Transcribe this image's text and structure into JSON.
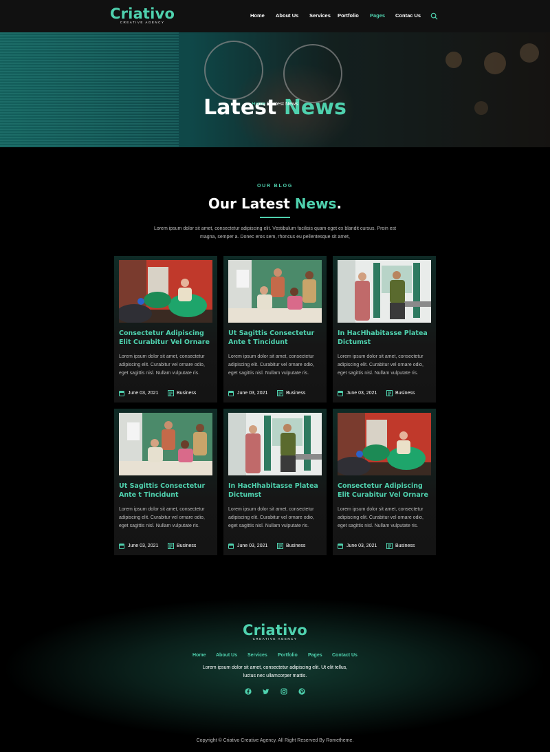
{
  "brand": {
    "name": "Criativo",
    "tagline": "CREATIVE AGENCY",
    "accent": "#4fd1ae"
  },
  "nav": {
    "items": [
      "Home",
      "About Us",
      "Services",
      "Portfolio",
      "Pages",
      "Contac Us"
    ],
    "active": "Pages",
    "search_icon": "search-icon"
  },
  "hero": {
    "title_part1": "Latest",
    "title_part2": "News",
    "crumb_home": "Home",
    "crumb_sep": " / ",
    "crumb_current": "Latest News"
  },
  "blog_section": {
    "label": "OUR BLOG",
    "title_part1": "Our Latest",
    "title_part2": "News",
    "title_end": ".",
    "description": "Lorem ipsum dolor sit amet, consectetur adipiscing elit. Vestibulum facilisis quam eget ex blandit cursus. Proin est magna, semper a. Donec eros sem, rhoncus eu pellentesque sit amet,"
  },
  "posts": [
    {
      "title": "Consectetur Adipiscing Elit Curabitur Vel Ornare",
      "excerpt": "Lorem ipsum dolor sit amet, consectetur adipiscing elit. Curabitur vel ornare odio, eget sagittis nisl. Nullam vulputate ris.",
      "date": "June 03, 2021",
      "category": "Business",
      "image": "beanbag-office-photo"
    },
    {
      "title": "Ut Sagittis Consectetur Ante t Tincidunt",
      "excerpt": "Lorem ipsum dolor sit amet, consectetur adipiscing elit. Curabitur vel ornare odio, eget sagittis nisl. Nullam vulputate ris.",
      "date": "June 03, 2021",
      "category": "Business",
      "image": "team-meeting-photo"
    },
    {
      "title": "In HacHhabitasse Platea Dictumst",
      "excerpt": "Lorem ipsum dolor sit amet, consectetur adipiscing elit. Curabitur vel ornare odio, eget sagittis nisl. Nullam vulputate ris.",
      "date": "June 03, 2021",
      "category": "Business",
      "image": "office-conversation-photo"
    },
    {
      "title": "Ut Sagittis Consectetur Ante t Tincidunt",
      "excerpt": "Lorem ipsum dolor sit amet, consectetur adipiscing elit. Curabitur vel ornare odio, eget sagittis nisl. Nullam vulputate ris.",
      "date": "June 03, 2021",
      "category": "Business",
      "image": "team-meeting-photo"
    },
    {
      "title": "In HacHhabitasse Platea Dictumst",
      "excerpt": "Lorem ipsum dolor sit amet, consectetur adipiscing elit. Curabitur vel ornare odio, eget sagittis nisl. Nullam vulputate ris.",
      "date": "June 03, 2021",
      "category": "Business",
      "image": "office-conversation-photo"
    },
    {
      "title": "Consectetur Adipiscing Elit Curabitur Vel Ornare",
      "excerpt": "Lorem ipsum dolor sit amet, consectetur adipiscing elit. Curabitur vel ornare odio, eget sagittis nisl. Nullam vulputate ris.",
      "date": "June 03, 2021",
      "category": "Business",
      "image": "beanbag-office-photo"
    }
  ],
  "footer": {
    "nav": [
      "Home",
      "About Us",
      "Services",
      "Portfolio",
      "Pages",
      "Contact Us"
    ],
    "description": "Lorem ipsum dolor sit amet, consectetur adipiscing elit. Ut elit tellus, luctus nec ullamcorper mattis.",
    "socials": [
      "facebook-icon",
      "twitter-icon",
      "instagram-icon",
      "pinterest-icon"
    ],
    "copyright": "Copyright © Criativo Creative Agency. All Right Reserved By Rometheme."
  }
}
